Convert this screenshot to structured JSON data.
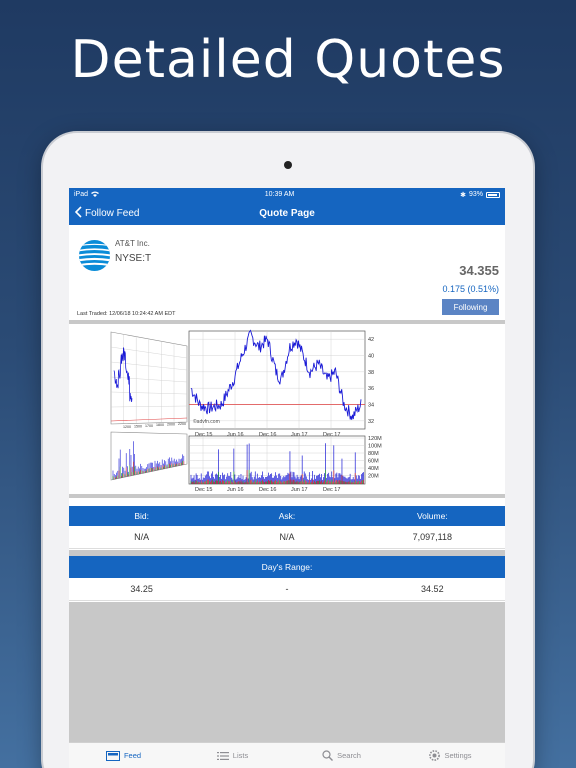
{
  "headline": "Detailed Quotes",
  "status_bar": {
    "device": "iPad",
    "time": "10:39 AM",
    "battery": "93%"
  },
  "nav": {
    "back_label": "Follow Feed",
    "title": "Quote Page"
  },
  "quote": {
    "company": "AT&T Inc.",
    "symbol": "NYSE:T",
    "price": "34.355",
    "change": "0.175 (0.51%)",
    "follow_label": "Following",
    "last_traded": "Last Traded: 12/06/18 10:24:42 AM EDT",
    "brand_color": "#0a8cd8"
  },
  "chart": {
    "watermark": "©advfn.com",
    "price_ticks": [
      "42",
      "40",
      "38",
      "36",
      "34",
      "32"
    ],
    "volume_ticks": [
      "120M",
      "100M",
      "80M",
      "60M",
      "40M",
      "20M"
    ],
    "date_ticks": [
      "Dec 15",
      "Jun 16",
      "Dec 16",
      "Jun 17",
      "Dec 17"
    ],
    "mini_ticks": [
      "1200",
      "1500",
      "1700",
      "1800",
      "2000",
      "2200"
    ]
  },
  "stats": {
    "headers": [
      "Bid:",
      "Ask:",
      "Volume:"
    ],
    "values": [
      "N/A",
      "N/A",
      "7,097,118"
    ]
  },
  "range": {
    "header": "Day's Range:",
    "low": "34.25",
    "dash": "-",
    "high": "34.52"
  },
  "tabs": [
    {
      "label": "Feed",
      "icon": "feed-icon"
    },
    {
      "label": "Lists",
      "icon": "list-icon"
    },
    {
      "label": "Search",
      "icon": "search-icon"
    },
    {
      "label": "Settings",
      "icon": "gear-icon"
    }
  ],
  "colors": {
    "accent": "#1565c0",
    "button": "#5b84c4",
    "price_line": "#1a1ad6",
    "ref_line": "#e04040"
  }
}
